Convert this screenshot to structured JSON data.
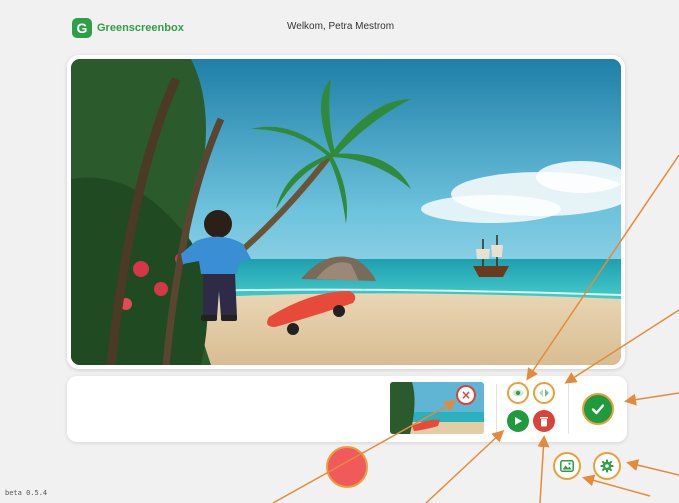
{
  "header": {
    "logo_mark": "G",
    "logo_text": "Greenscreenbox",
    "welcome": "Welkom, Petra Mestrom"
  },
  "stage": {
    "scene": "beach-scene-with-doll-and-skateboard"
  },
  "clip_panel": {
    "thumbnail_icon": "scene-thumbnail",
    "remove_icon": "close-icon",
    "remove_label": "×",
    "tools": [
      {
        "name": "eye-icon",
        "style": "outline",
        "color": "#2e9e47"
      },
      {
        "name": "flip-icon",
        "style": "outline",
        "color": "#2e9e47"
      },
      {
        "name": "play-icon",
        "style": "filled",
        "color": "#1f9a3f"
      },
      {
        "name": "trash-icon",
        "style": "filled",
        "color": "#d8443a"
      }
    ],
    "confirm_icon": "check-icon"
  },
  "controls": {
    "record_icon": "record-icon",
    "background_icon": "image-icon",
    "settings_icon": "gear-icon"
  },
  "version": "beta 0.5.4",
  "colors": {
    "brand_green": "#2e9e47",
    "accent_orange": "#e9a03c",
    "danger_red": "#d8443a",
    "record_red": "#f05a5a",
    "annotation_orange": "#e58a3a"
  }
}
